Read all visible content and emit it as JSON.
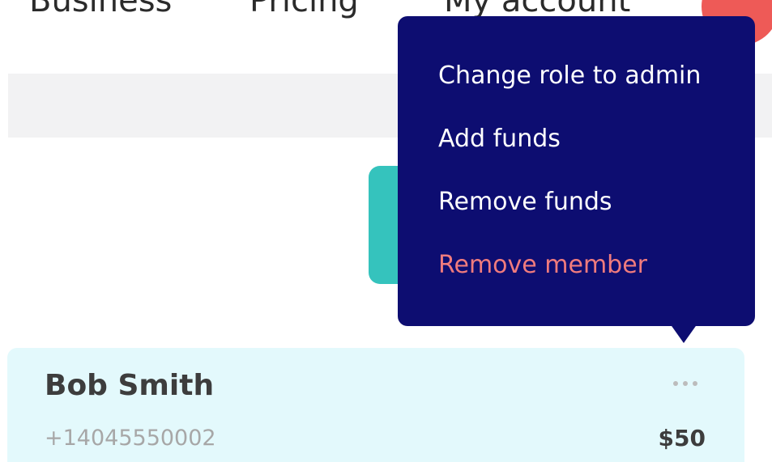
{
  "nav": {
    "business_label": "Business",
    "pricing_label": "Pricing",
    "account_label": "My account"
  },
  "member": {
    "name": "Bob Smith",
    "phone": "+14045550002",
    "balance": "$50",
    "more_icon": "more-horizontal-icon"
  },
  "menu": {
    "items": [
      {
        "label": "Change role to admin"
      },
      {
        "label": "Add funds"
      },
      {
        "label": "Remove funds"
      },
      {
        "label": "Remove member"
      }
    ]
  },
  "colors": {
    "menu_background": "#0d0d71",
    "danger": "#f07b7d",
    "accent_teal": "#35c3bd",
    "card_background": "#e3f9fc",
    "avatar": "#ee5a57"
  }
}
